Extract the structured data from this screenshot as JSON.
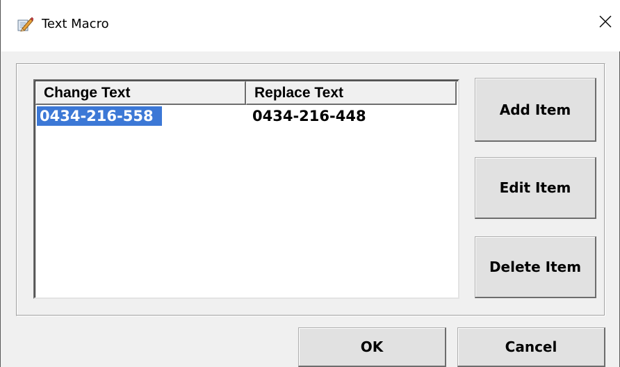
{
  "window": {
    "title": "Text Macro",
    "icon": "pencil-paper-icon",
    "close_glyph": "✕"
  },
  "list": {
    "columns": [
      "Change Text",
      "Replace Text"
    ],
    "rows": [
      {
        "change": "0434-216-558",
        "replace": "0434-216-448",
        "selected": true
      }
    ]
  },
  "buttons": {
    "add": "Add Item",
    "edit": "Edit Item",
    "delete": "Delete Item",
    "ok": "OK",
    "cancel": "Cancel"
  },
  "colors": {
    "selection": "#3c78d6",
    "face": "#f0f0f0"
  }
}
